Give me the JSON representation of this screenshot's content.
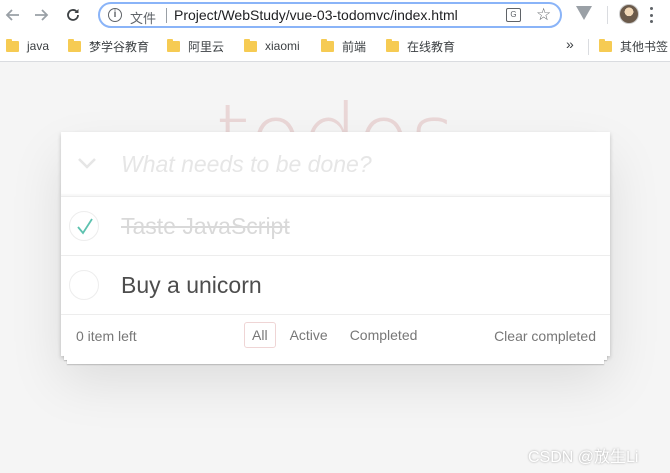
{
  "browser": {
    "url_scheme": "文件",
    "url": "Project/WebStudy/vue-03-todomvc/index.html",
    "bookmarks": [
      {
        "label": "java"
      },
      {
        "label": "梦学谷教育"
      },
      {
        "label": "阿里云"
      },
      {
        "label": "xiaomi"
      },
      {
        "label": "前端"
      },
      {
        "label": "在线教育"
      }
    ],
    "more_bookmarks": "»",
    "other_bookmarks": "其他书签"
  },
  "app": {
    "title": "todos",
    "new_todo_placeholder": "What needs to be done?",
    "todos": [
      {
        "title": "Taste JavaScript",
        "completed": true
      },
      {
        "title": "Buy a unicorn",
        "completed": false
      }
    ],
    "footer": {
      "count_text": "0 item left",
      "filters": [
        "All",
        "Active",
        "Completed"
      ],
      "selected_filter": "All",
      "clear_label": "Clear completed"
    }
  },
  "watermark": "CSDN @放生Li",
  "colors": {
    "title": "#af2f2f",
    "check": "#5dc2af",
    "url_focus": "#8ab4f8"
  }
}
